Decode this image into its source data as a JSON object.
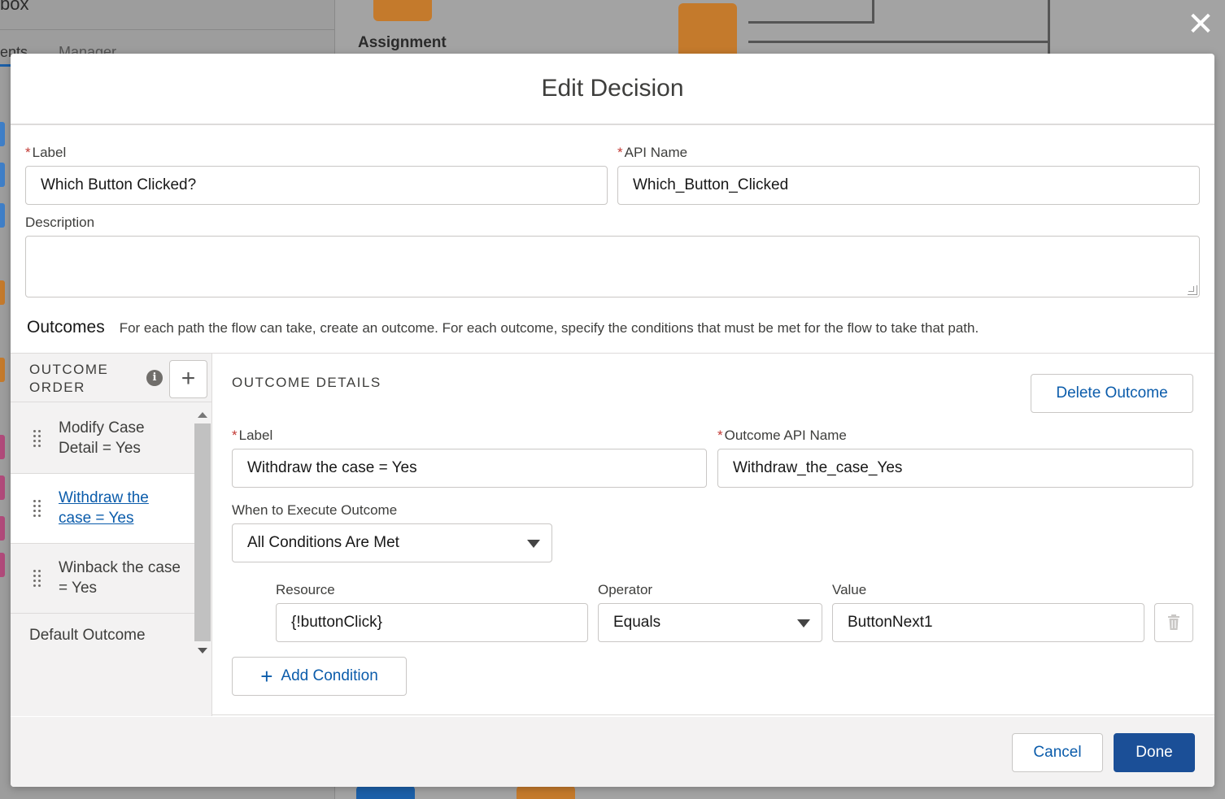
{
  "background": {
    "toolbox_title": "box",
    "tabs": [
      "ents",
      "Manager"
    ],
    "assignment_label": "Assignment"
  },
  "modal": {
    "title": "Edit Decision",
    "label": {
      "caption": "Label",
      "value": "Which Button Clicked?"
    },
    "api_name": {
      "caption": "API Name",
      "value": "Which_Button_Clicked"
    },
    "description": {
      "caption": "Description",
      "value": ""
    },
    "outcomes": {
      "title": "Outcomes",
      "help": "For each path the flow can take, create an outcome. For each outcome, specify the conditions that must be met for the flow to take that path."
    },
    "outcome_order": {
      "title": "OUTCOME ORDER",
      "items": [
        {
          "label": "Modify Case Detail = Yes",
          "selected": false
        },
        {
          "label": "Withdraw the case = Yes",
          "selected": true
        },
        {
          "label": "Winback the case = Yes",
          "selected": false
        }
      ],
      "default_label": "Default Outcome"
    },
    "outcome_details": {
      "title": "OUTCOME DETAILS",
      "delete_label": "Delete Outcome",
      "label": {
        "caption": "Label",
        "value": "Withdraw the case = Yes"
      },
      "api_name": {
        "caption": "Outcome API Name",
        "value": "Withdraw_the_case_Yes"
      },
      "when": {
        "caption": "When to Execute Outcome",
        "value": "All Conditions Are Met"
      },
      "condition": {
        "resource_caption": "Resource",
        "resource_value": "{!buttonClick}",
        "operator_caption": "Operator",
        "operator_value": "Equals",
        "value_caption": "Value",
        "value_value": "ButtonNext1"
      },
      "add_condition_label": "Add Condition"
    },
    "footer": {
      "cancel_label": "Cancel",
      "done_label": "Done"
    }
  },
  "colors": {
    "brand": "#1b4f97",
    "link": "#0b5cab",
    "required": "#c23934",
    "node": "#c47a2c"
  },
  "icons": [
    "close-icon",
    "info-icon",
    "plus-icon",
    "drag-handle-icon",
    "chevron-down-icon",
    "trash-icon"
  ]
}
